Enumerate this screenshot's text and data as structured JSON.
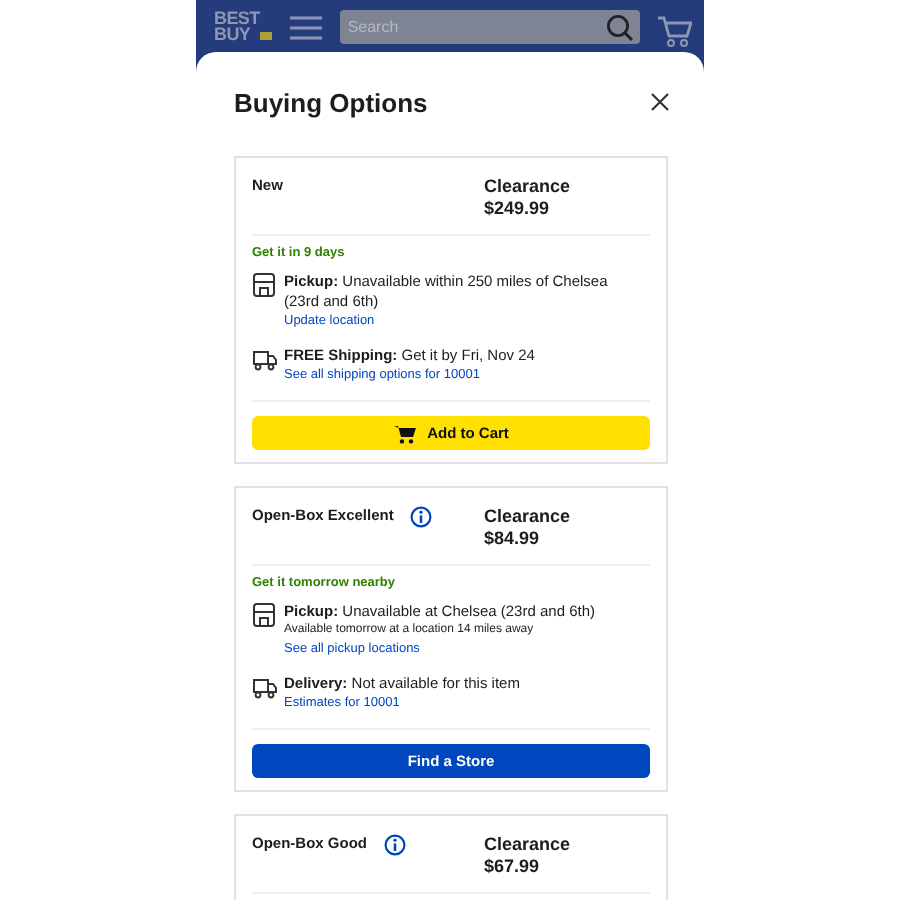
{
  "header": {
    "logo": [
      "BEST",
      "BUY"
    ],
    "search": {
      "placeholder": "Search"
    }
  },
  "sheet": {
    "title": "Buying Options"
  },
  "options": [
    {
      "condition": "New",
      "info": false,
      "label": "Clearance",
      "price": "$249.99",
      "availability": "Get it in 9 days",
      "fulfillment": [
        {
          "kind": "pickup",
          "label": "Pickup:",
          "text": "Unavailable within 250 miles of Chelsea (23rd and 6th)",
          "link": "Update location"
        },
        {
          "kind": "shipping",
          "label": "FREE Shipping:",
          "text": "Get it by Fri, Nov 24",
          "link": "See all shipping options for 10001"
        }
      ],
      "button": {
        "kind": "cart",
        "label": "Add to Cart"
      }
    },
    {
      "condition": "Open-Box Excellent",
      "info": true,
      "label": "Clearance",
      "price": "$84.99",
      "availability": "Get it tomorrow nearby",
      "fulfillment": [
        {
          "kind": "pickup",
          "label": "Pickup:",
          "text": "Unavailable at Chelsea (23rd and 6th)",
          "note": "Available tomorrow at a location 14 miles away",
          "link": "See all pickup locations"
        },
        {
          "kind": "shipping",
          "label": "Delivery:",
          "text": "Not available for this item",
          "link": "Estimates for 10001"
        }
      ],
      "button": {
        "kind": "store",
        "label": "Find a Store"
      }
    },
    {
      "condition": "Open-Box Good",
      "info": true,
      "label": "Clearance",
      "price": "$67.99"
    }
  ]
}
